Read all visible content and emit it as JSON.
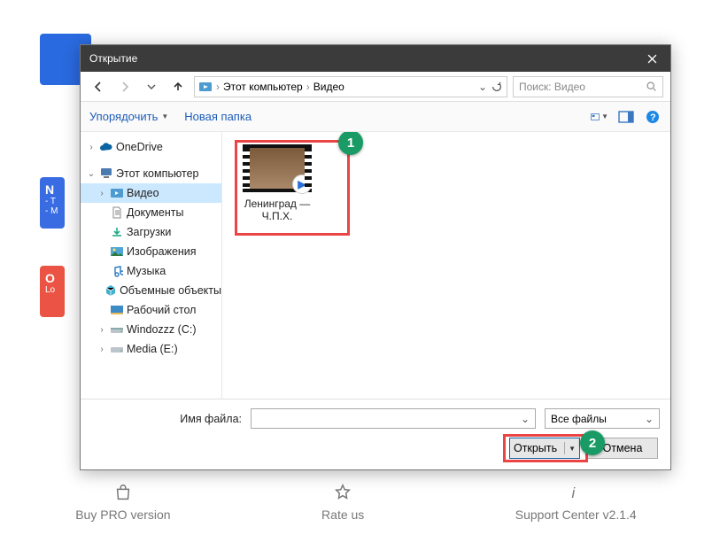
{
  "background": {
    "chip_blue": "N",
    "chip_blue_sub1": "- T",
    "chip_blue_sub2": "- M",
    "chip_red": "O",
    "chip_red_sub": "Lo"
  },
  "footer": {
    "buy": "Buy PRO version",
    "rate": "Rate us",
    "support": "Support Center  v2.1.4"
  },
  "dialog": {
    "title": "Открытие"
  },
  "nav": {
    "crumb1": "Этот компьютер",
    "crumb2": "Видео",
    "search_placeholder": "Поиск: Видео"
  },
  "toolbar": {
    "organize": "Упорядочить",
    "new_folder": "Новая папка"
  },
  "tree": {
    "onedrive": "OneDrive",
    "this_pc": "Этот компьютер",
    "videos": "Видео",
    "documents": "Документы",
    "downloads": "Загрузки",
    "pictures": "Изображения",
    "music": "Музыка",
    "objects3d": "Объемные объекты",
    "desktop": "Рабочий стол",
    "drive_c": "Windozzz (C:)",
    "drive_e": "Media (E:)"
  },
  "file": {
    "name_line1": "Ленинград —",
    "name_line2": "Ч.П.Х."
  },
  "markers": {
    "one": "1",
    "two": "2"
  },
  "bottom": {
    "fname_label": "Имя файла:",
    "fname_value": "",
    "filter": "Все файлы",
    "open": "Открыть",
    "cancel": "Отмена"
  }
}
